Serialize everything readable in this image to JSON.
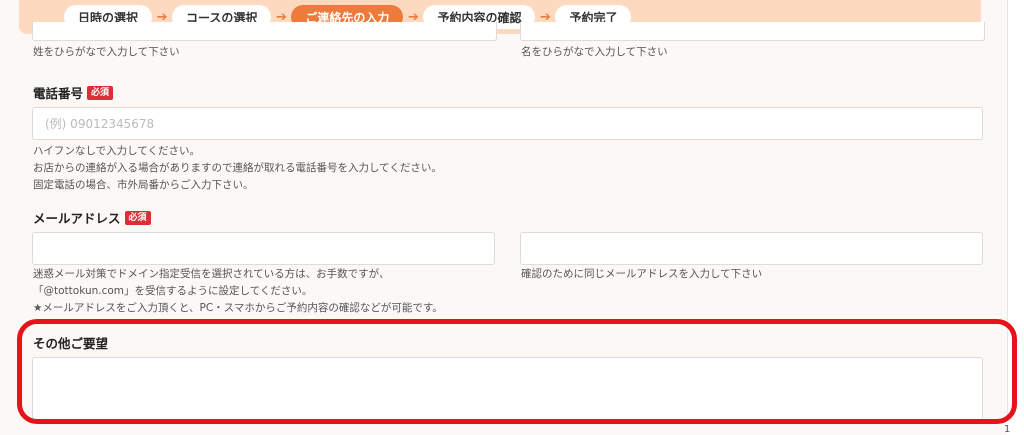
{
  "steps": [
    {
      "label": "日時の選択",
      "active": false
    },
    {
      "label": "コースの選択",
      "active": false
    },
    {
      "label": "ご連絡先の入力",
      "active": true
    },
    {
      "label": "予約内容の確認",
      "active": false
    },
    {
      "label": "予約完了",
      "active": false
    }
  ],
  "name": {
    "last_hint": "姓をひらがなで入力して下さい",
    "first_hint": "名をひらがなで入力して下さい"
  },
  "phone": {
    "label": "電話番号",
    "required_badge": "必須",
    "placeholder": "(例) 09012345678",
    "hints": [
      "ハイフンなしで入力してください。",
      "お店からの連絡が入る場合がありますので連絡が取れる電話番号を入力してください。",
      "固定電話の場合、市外局番からご入力下さい。"
    ]
  },
  "email": {
    "label": "メールアドレス",
    "required_badge": "必須",
    "hints": [
      "迷惑メール対策でドメイン指定受信を選択されている方は、お手数ですが、",
      "「@tottokun.com」を受信するように設定してください。",
      "★メールアドレスをご入力頂くと、PC・スマホからご予約内容の確認などが可能です。"
    ],
    "confirm_hint": "確認のために同じメールアドレスを入力して下さい"
  },
  "other": {
    "label": "その他ご要望"
  },
  "edge_mark": "1",
  "colors": {
    "accent": "#ed7b3d",
    "stepbar_bg": "#fcd9bf",
    "required": "#d93035",
    "highlight": "#e8121b"
  }
}
